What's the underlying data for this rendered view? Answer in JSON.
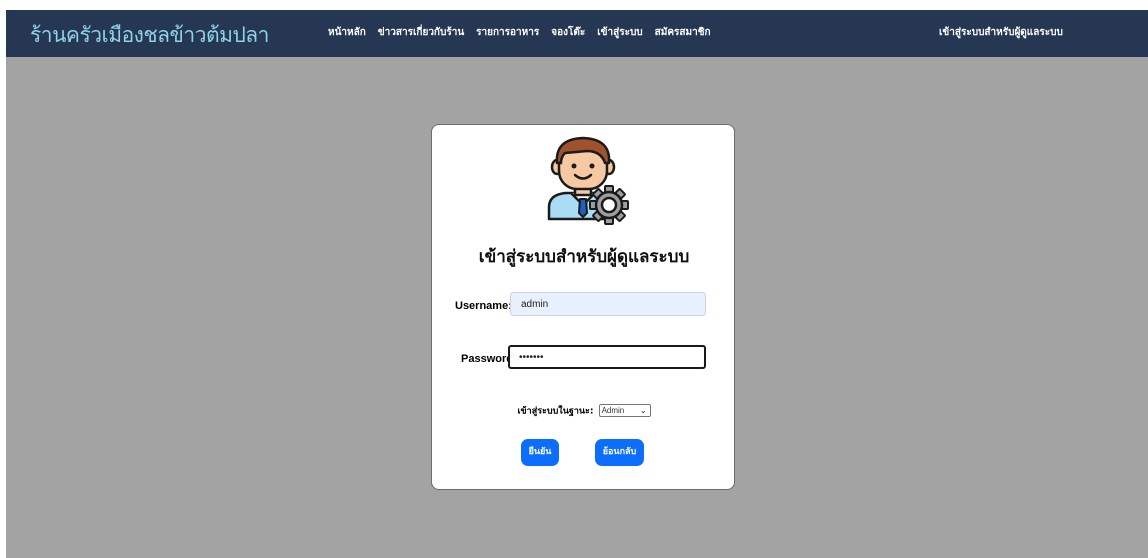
{
  "navbar": {
    "brand": "ร้านครัวเมืองชลข้าวต้มปลา",
    "links": [
      "หน้าหลัก",
      "ข่าวสารเกี่ยวกับร้าน",
      "รายการอาหาร",
      "จองโต๊ะ",
      "เข้าสู่ระบบ",
      "สมัครสมาชิก"
    ],
    "admin_link": "เข้าสู่ระบบสำหรับผู้ดูแลระบบ"
  },
  "login": {
    "avatar_icon": "admin-user-gear-icon",
    "title": "เข้าสู่ระบบสำหรับผู้ดูแลระบบ",
    "username_label": "Username:",
    "username_value": "admin",
    "password_label": "Password:",
    "password_value": "•••••••",
    "role_label": "เข้าสู่ระบบในฐานะ:",
    "role_selected": "Admin",
    "confirm_label": "ยืนยัน",
    "back_label": "ย้อนกลับ"
  },
  "colors": {
    "navbar_bg": "#253753",
    "brand": "#8fd3ea",
    "page_bg": "#a3a3a3",
    "button": "#0d6efd"
  }
}
